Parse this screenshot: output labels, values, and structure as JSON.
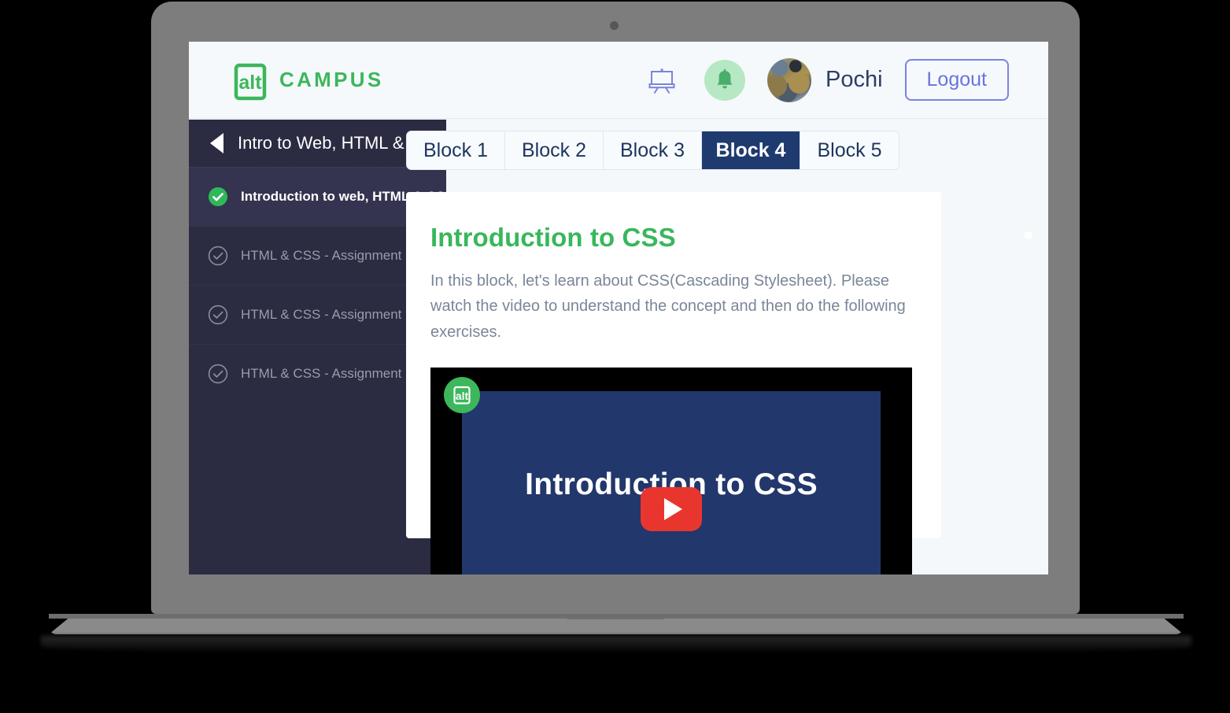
{
  "device": {
    "type": "laptop-mockup",
    "bezel_color": "#7d7d7d",
    "base_color": "#8a8a8a"
  },
  "header": {
    "brand": {
      "mark_text": "alt",
      "word": "CAMPUS",
      "color": "#3cb75b"
    },
    "easel_icon": "whiteboard-easel-icon",
    "bell_icon": "notification-bell-icon",
    "bell_bg": "#b6e8c3",
    "avatar_alt": "user-avatar",
    "username": "Pochi",
    "logout_label": "Logout",
    "logout_color": "#6a73de"
  },
  "sidebar": {
    "collapse_icon": "arrow-left-icon",
    "back_icon": "caret-left-icon",
    "course_title": "Intro to Web, HTML & CSS",
    "lessons": [
      {
        "label": "Introduction to web,  HTML & CSS",
        "state": "complete-active",
        "icon": "check-circle-filled-icon"
      },
      {
        "label": "HTML & CSS - Assignment I",
        "state": "incomplete",
        "icon": "check-circle-outline-icon"
      },
      {
        "label": "HTML & CSS - Assignment II",
        "state": "incomplete",
        "icon": "check-circle-outline-icon"
      },
      {
        "label": "HTML & CSS - Assignment III",
        "state": "incomplete",
        "icon": "check-circle-outline-icon"
      }
    ]
  },
  "main": {
    "tabs": [
      {
        "label": "Block 1",
        "active": false
      },
      {
        "label": "Block 2",
        "active": false
      },
      {
        "label": "Block 3",
        "active": false
      },
      {
        "label": "Block 4",
        "active": true
      },
      {
        "label": "Block 5",
        "active": false
      }
    ],
    "active_tab": "Block 4",
    "title": "Introduction to CSS",
    "title_color": "#38b75b",
    "paragraph": "In this block, let's learn about CSS(Cascading Stylesheet). Please watch the video to understand the concept and then do the following exercises.",
    "video": {
      "slide_title": "Introduction to CSS",
      "slide_bg": "#22376b",
      "play_button": "youtube-play-icon",
      "play_color": "#e8362f",
      "watermark_text": "alt",
      "watermark_bg": "#3cb75b"
    }
  }
}
